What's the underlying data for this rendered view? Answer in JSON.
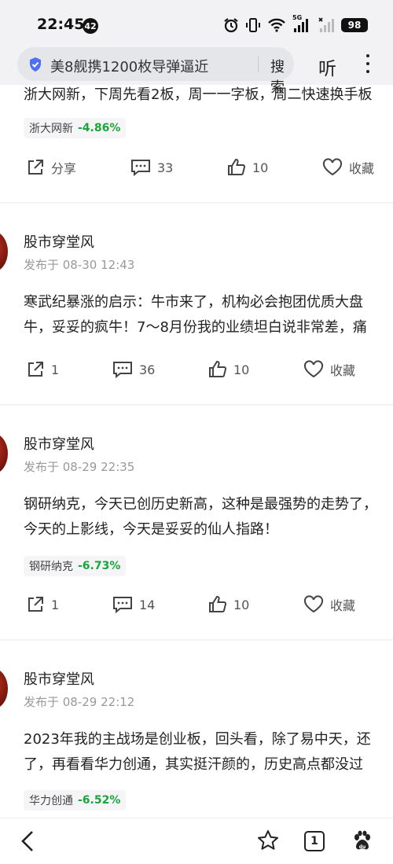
{
  "status": {
    "time": "22:45",
    "notif_count": "42",
    "network": "5G",
    "battery": "98"
  },
  "header": {
    "search_text": "美8舰携1200枚导弹逼近",
    "search_button": "搜索",
    "listen_button": "听"
  },
  "posts": [
    {
      "lines": [
        "浙大网新，下周先看2板，周一一字板，周二快速换手板"
      ],
      "tag": {
        "name": "浙大网新",
        "change": "-4.86%"
      },
      "actions": {
        "share": "分享",
        "comments": "33",
        "likes": "10",
        "favorite": "收藏"
      }
    },
    {
      "author": "股市穿堂风",
      "time": "发布于 08-30 12:43",
      "lines": [
        "寒武纪暴涨的启示：牛市来了，机构必会抱团优质大盘",
        "牛，妥妥的疯牛！7～8月份我的业绩坦白说非常差，痛"
      ],
      "actions": {
        "share": "1",
        "comments": "36",
        "likes": "10",
        "favorite": "收藏"
      }
    },
    {
      "author": "股市穿堂风",
      "time": "发布于 08-29 22:35",
      "lines": [
        "钢研纳克，今天已创历史新高，这种是最强势的走势了，",
        "今天的上影线，今天是妥妥的仙人指路！"
      ],
      "tag": {
        "name": "钢研纳克",
        "change": "-6.73%"
      },
      "actions": {
        "share": "1",
        "comments": "14",
        "likes": "10",
        "favorite": "收藏"
      }
    },
    {
      "author": "股市穿堂风",
      "time": "发布于 08-29 22:12",
      "lines": [
        "2023年我的主战场是创业板，回头看，除了易中天，还",
        "了，再看看华力创通，其实挺汗颜的，历史高点都没过"
      ],
      "tag": {
        "name": "华力创通",
        "change": "-6.52%"
      }
    }
  ],
  "bottom_nav": {
    "tab_count": "1"
  },
  "colors": {
    "tag_change": "#1ea33a",
    "shield": "#4f6ef2"
  }
}
